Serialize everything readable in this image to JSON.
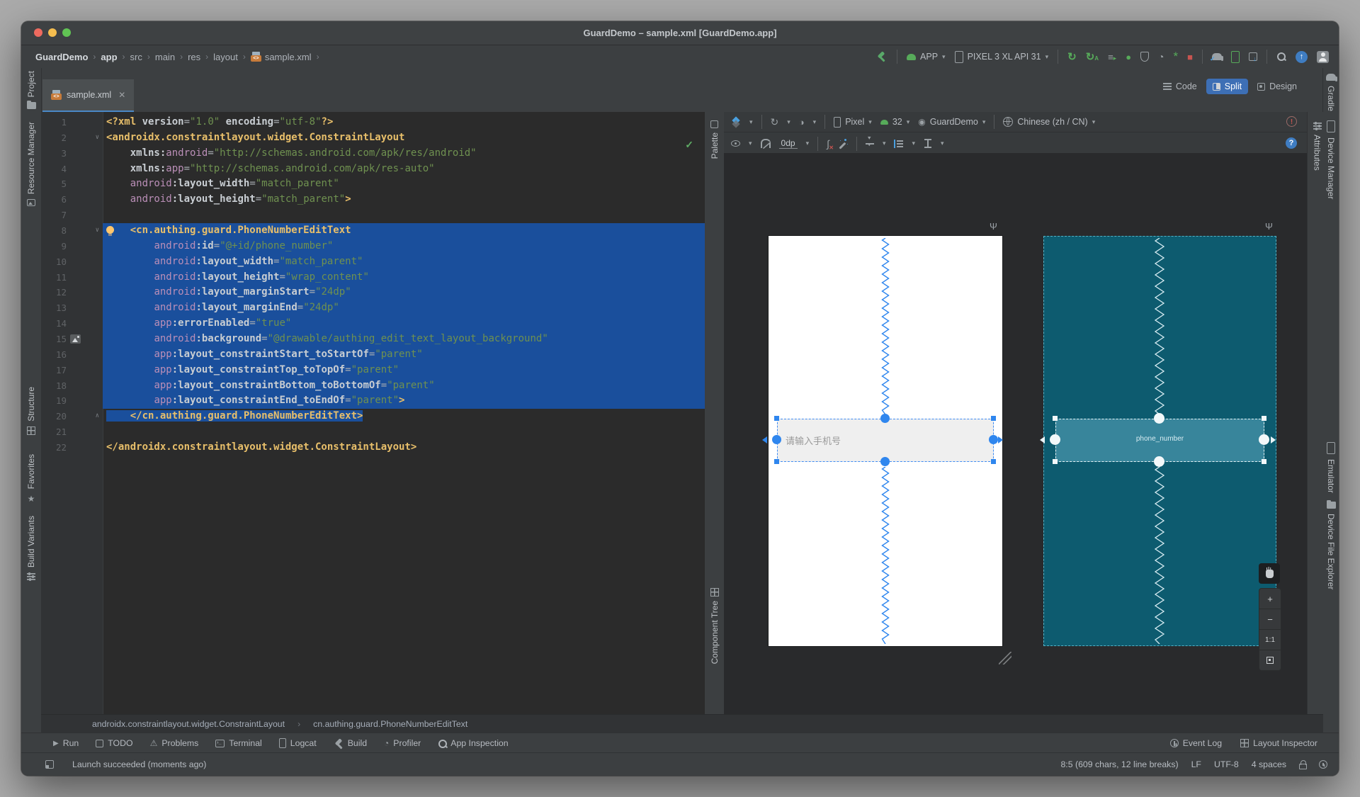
{
  "window": {
    "title": "GuardDemo – sample.xml [GuardDemo.app]"
  },
  "toolbar": {
    "breadcrumbs": [
      "GuardDemo",
      "app",
      "src",
      "main",
      "res",
      "layout",
      "sample.xml"
    ],
    "run_config": "APP",
    "device": "PIXEL 3 XL API 31"
  },
  "tab": {
    "label": "sample.xml"
  },
  "left_stripe": {
    "project": "Project",
    "resource_manager": "Resource Manager",
    "structure": "Structure",
    "favorites": "Favorites",
    "build_variants": "Build Variants"
  },
  "right_stripe": {
    "gradle": "Gradle",
    "device_manager": "Device Manager",
    "attributes": "Attributes",
    "emulator": "Emulator",
    "device_file_explorer": "Device File Explorer"
  },
  "design": {
    "mode_toggle": {
      "code": "Code",
      "split": "Split",
      "design": "Design"
    },
    "toolbar": {
      "device": "Pixel",
      "api_level": "32",
      "theme": "GuardDemo",
      "locale": "Chinese (zh / CN)",
      "default_margin": "0dp"
    },
    "palette_label": "Palette",
    "component_tree_label": "Component Tree",
    "preview": {
      "hint_text": "请输入手机号",
      "widget_id": "phone_number"
    },
    "zoom": {
      "plus": "+",
      "minus": "−",
      "one_to_one": "1:1"
    }
  },
  "editor": {
    "lines": [
      {
        "n": 1,
        "tok": [
          [
            "t",
            "<?xml "
          ],
          [
            "n",
            "version"
          ],
          [
            "e",
            "="
          ],
          [
            "q",
            "\"1.0\""
          ],
          [
            "w",
            " "
          ],
          [
            "n",
            "encoding"
          ],
          [
            "e",
            "="
          ],
          [
            "q",
            "\"utf-8\""
          ],
          [
            "t",
            "?>"
          ]
        ]
      },
      {
        "n": 2,
        "fold": "down",
        "tok": [
          [
            "t",
            "<androidx.constraintlayout.widget.ConstraintLayout"
          ]
        ]
      },
      {
        "n": 3,
        "tok": [
          [
            "w",
            "    "
          ],
          [
            "n",
            "xmlns:"
          ],
          [
            "a",
            "android"
          ],
          [
            "e",
            "="
          ],
          [
            "q",
            "\"http://schemas.android.com/apk/res/android\""
          ]
        ]
      },
      {
        "n": 4,
        "tok": [
          [
            "w",
            "    "
          ],
          [
            "n",
            "xmlns:"
          ],
          [
            "a",
            "app"
          ],
          [
            "e",
            "="
          ],
          [
            "q",
            "\"http://schemas.android.com/apk/res-auto\""
          ]
        ]
      },
      {
        "n": 5,
        "tok": [
          [
            "w",
            "    "
          ],
          [
            "a",
            "android"
          ],
          [
            "n",
            ":layout_width"
          ],
          [
            "e",
            "="
          ],
          [
            "q",
            "\"match_parent\""
          ]
        ]
      },
      {
        "n": 6,
        "tok": [
          [
            "w",
            "    "
          ],
          [
            "a",
            "android"
          ],
          [
            "n",
            ":layout_height"
          ],
          [
            "e",
            "="
          ],
          [
            "q",
            "\"match_parent\""
          ],
          [
            "t",
            ">"
          ]
        ]
      },
      {
        "n": 7,
        "tok": []
      },
      {
        "n": 8,
        "sel": "full",
        "fold": "down",
        "bulb": true,
        "tok": [
          [
            "w",
            "    "
          ],
          [
            "t",
            "<cn.authing.guard.PhoneNumberEditText"
          ]
        ]
      },
      {
        "n": 9,
        "sel": "full",
        "tok": [
          [
            "w",
            "        "
          ],
          [
            "a",
            "android"
          ],
          [
            "n",
            ":id"
          ],
          [
            "e",
            "="
          ],
          [
            "q",
            "\"@+id/phone_number\""
          ]
        ]
      },
      {
        "n": 10,
        "sel": "full",
        "tok": [
          [
            "w",
            "        "
          ],
          [
            "a",
            "android"
          ],
          [
            "n",
            ":layout_width"
          ],
          [
            "e",
            "="
          ],
          [
            "q",
            "\"match_parent\""
          ]
        ]
      },
      {
        "n": 11,
        "sel": "full",
        "tok": [
          [
            "w",
            "        "
          ],
          [
            "a",
            "android"
          ],
          [
            "n",
            ":layout_height"
          ],
          [
            "e",
            "="
          ],
          [
            "q",
            "\"wrap_content\""
          ]
        ]
      },
      {
        "n": 12,
        "sel": "full",
        "tok": [
          [
            "w",
            "        "
          ],
          [
            "a",
            "android"
          ],
          [
            "n",
            ":layout_marginStart"
          ],
          [
            "e",
            "="
          ],
          [
            "q",
            "\"24dp\""
          ]
        ]
      },
      {
        "n": 13,
        "sel": "full",
        "tok": [
          [
            "w",
            "        "
          ],
          [
            "a",
            "android"
          ],
          [
            "n",
            ":layout_marginEnd"
          ],
          [
            "e",
            "="
          ],
          [
            "q",
            "\"24dp\""
          ]
        ]
      },
      {
        "n": 14,
        "sel": "full",
        "tok": [
          [
            "w",
            "        "
          ],
          [
            "a",
            "app"
          ],
          [
            "n",
            ":errorEnabled"
          ],
          [
            "e",
            "="
          ],
          [
            "q",
            "\"true\""
          ]
        ]
      },
      {
        "n": 15,
        "sel": "full",
        "gutter": "image",
        "tok": [
          [
            "w",
            "        "
          ],
          [
            "a",
            "android"
          ],
          [
            "n",
            ":background"
          ],
          [
            "e",
            "="
          ],
          [
            "q",
            "\"@drawable/authing_edit_text_layout_background\""
          ]
        ]
      },
      {
        "n": 16,
        "sel": "full",
        "tok": [
          [
            "w",
            "        "
          ],
          [
            "a",
            "app"
          ],
          [
            "n",
            ":layout_constraintStart_toStartOf"
          ],
          [
            "e",
            "="
          ],
          [
            "q",
            "\"parent\""
          ]
        ]
      },
      {
        "n": 17,
        "sel": "full",
        "tok": [
          [
            "w",
            "        "
          ],
          [
            "a",
            "app"
          ],
          [
            "n",
            ":layout_constraintTop_toTopOf"
          ],
          [
            "e",
            "="
          ],
          [
            "q",
            "\"parent\""
          ]
        ]
      },
      {
        "n": 18,
        "sel": "full",
        "tok": [
          [
            "w",
            "        "
          ],
          [
            "a",
            "app"
          ],
          [
            "n",
            ":layout_constraintBottom_toBottomOf"
          ],
          [
            "e",
            "="
          ],
          [
            "q",
            "\"parent\""
          ]
        ]
      },
      {
        "n": 19,
        "sel": "full",
        "tok": [
          [
            "w",
            "        "
          ],
          [
            "a",
            "app"
          ],
          [
            "n",
            ":layout_constraintEnd_toEndOf"
          ],
          [
            "e",
            "="
          ],
          [
            "q",
            "\"parent\""
          ],
          [
            "t",
            ">"
          ]
        ]
      },
      {
        "n": 20,
        "sel": "end",
        "fold": "up",
        "tok": [
          [
            "w",
            "    "
          ],
          [
            "t",
            "</cn.authing.guard.PhoneNumberEditText>"
          ]
        ]
      },
      {
        "n": 21,
        "tok": []
      },
      {
        "n": 22,
        "tok": [
          [
            "t",
            "</androidx.constraintlayout.widget.ConstraintLayout>"
          ]
        ]
      }
    ]
  },
  "breadcrumb_bar": {
    "parent": "androidx.constraintlayout.widget.ConstraintLayout",
    "child": "cn.authing.guard.PhoneNumberEditText"
  },
  "bottom_bar": {
    "left": [
      "Run",
      "TODO",
      "Problems",
      "Terminal",
      "Logcat",
      "Build",
      "Profiler",
      "App Inspection"
    ],
    "right": [
      "Event Log",
      "Layout Inspector"
    ]
  },
  "status_bar": {
    "message": "Launch succeeded (moments ago)",
    "position": "8:5 (609 chars, 12 line breaks)",
    "line_ending": "LF",
    "encoding": "UTF-8",
    "indent": "4 spaces"
  },
  "colors": {
    "accent_blue": "#2f86ee",
    "selection": "#1a4f9c",
    "tag": "#e8bf6a",
    "attr_prefix": "#bb8fb8",
    "string": "#6f9150",
    "blueprint_bg": "#0d5b6f",
    "blueprint_widget": "#38859b",
    "editor_bg": "#2b2b2b",
    "panel_bg": "#3c3f41"
  }
}
